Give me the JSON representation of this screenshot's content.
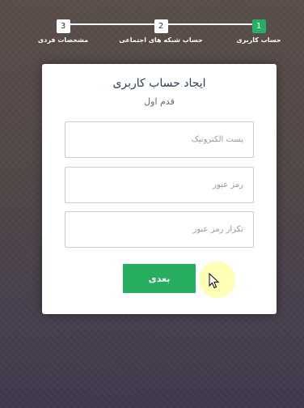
{
  "progress": {
    "steps": [
      {
        "number": "1",
        "label": "حساب کاربری",
        "active": true
      },
      {
        "number": "2",
        "label": "حساب شبکه های اجتماعی",
        "active": false
      },
      {
        "number": "3",
        "label": "مشخصات فردی",
        "active": false
      }
    ]
  },
  "form": {
    "title": "ایجاد حساب کاربری",
    "subtitle": "قدم اول",
    "email_placeholder": "پست الکترونیک",
    "password_placeholder": "رمز عبور",
    "confirm_placeholder": "تکرار رمز عبور",
    "next_label": "بعدی"
  },
  "colors": {
    "accent": "#27ae60",
    "title": "#2c3e50",
    "click_highlight": "#ffff78"
  },
  "icons": {
    "pointer": "mouse-pointer-icon"
  }
}
